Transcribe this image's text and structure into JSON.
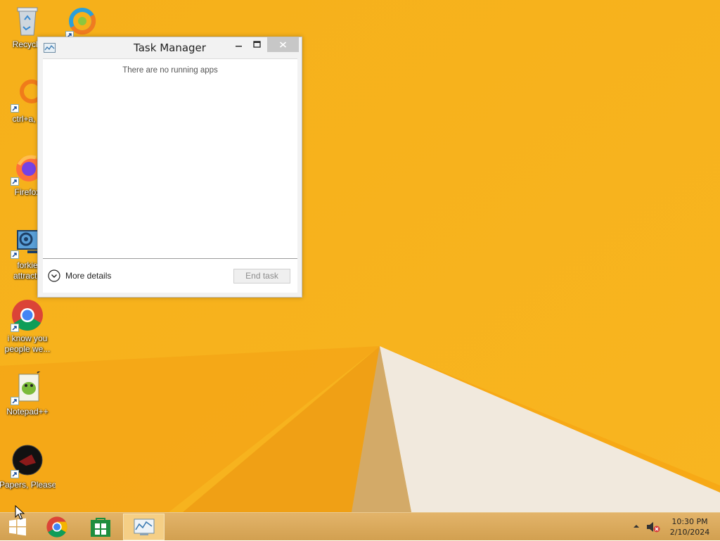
{
  "desktop": {
    "icons": [
      {
        "label": "Recycle",
        "icon": "recycle-bin-icon"
      },
      {
        "label": "",
        "icon": "browser-swirl-icon"
      },
      {
        "label": "ctrl+a, e",
        "icon": "orange-ring-app-icon"
      },
      {
        "label": "Firefox",
        "icon": "firefox-icon"
      },
      {
        "label": "forkie",
        "label2": "attracta",
        "icon": "settings-monitor-icon"
      },
      {
        "label": "i know you",
        "label2": "people we...",
        "icon": "chrome-icon"
      },
      {
        "label": "Notepad++",
        "icon": "notepadpp-icon"
      },
      {
        "label": "Papers, Please",
        "icon": "papers-please-icon"
      }
    ]
  },
  "task_manager": {
    "title": "Task Manager",
    "empty_message": "There are no running apps",
    "more_details_label": "More details",
    "end_task_label": "End task"
  },
  "taskbar": {
    "clock_time": "10:30 PM",
    "clock_date": "2/10/2024",
    "pinned": [
      "start-icon",
      "chrome-icon",
      "store-icon",
      "task-manager-icon"
    ]
  },
  "colors": {
    "wallpaper": "#f7b21b",
    "taskbar": "#d9a85a",
    "close_button": "#c7c7c7"
  }
}
